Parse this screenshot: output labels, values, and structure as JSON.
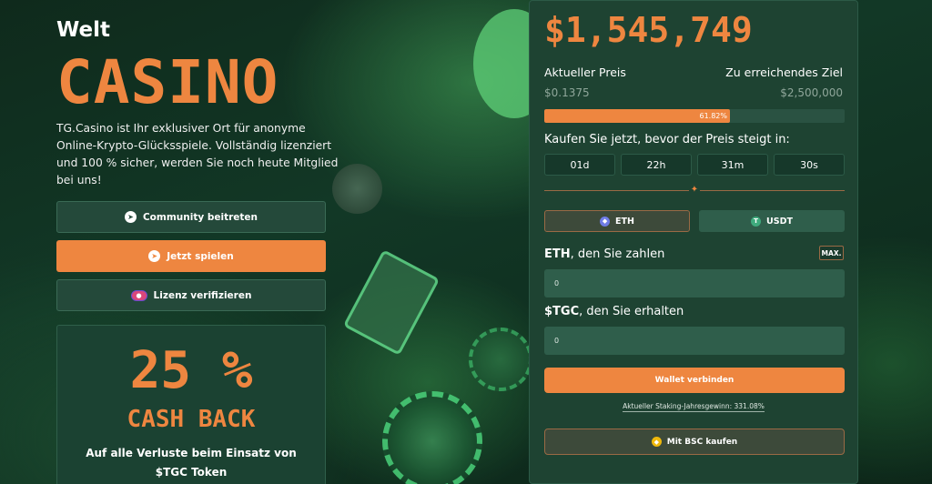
{
  "hero": {
    "welt": "Welt",
    "casino": "CASINO",
    "description": "TG.Casino ist Ihr exklusiver Ort für anonyme Online-Krypto-Glücksspiele. Vollständig lizenziert und 100 % sicher, werden Sie noch heute Mitglied bei uns!"
  },
  "buttons": {
    "community": "Community beitreten",
    "play": "Jetzt spielen",
    "license": "Lizenz verifizieren"
  },
  "icons": {
    "community": "telegram-icon",
    "play": "telegram-icon",
    "license": "license-badge-icon"
  },
  "cashback": {
    "percent": "25 %",
    "title": "CASH BACK",
    "description": "Auf alle Verluste beim Einsatz von $TGC Token"
  },
  "presale": {
    "raised": "$1,545,749",
    "current_price_label": "Aktueller Preis",
    "current_price": "$0.1375",
    "target_label": "Zu erreichendes Ziel",
    "target": "$2,500,000",
    "progress_percent": 61.82,
    "progress_label": "61.82%",
    "timer_label": "Kaufen Sie jetzt, bevor der Preis steigt in:",
    "timer": [
      "01d",
      "22h",
      "31m",
      "30s"
    ],
    "tokens": [
      {
        "label": "ETH",
        "icon": "eth-icon"
      },
      {
        "label": "USDT",
        "icon": "usdt-icon"
      }
    ],
    "pay_currency": "ETH",
    "pay_label_rest": ", den Sie zahlen",
    "max_label": "MAX.",
    "pay_value": "0",
    "receive_currency": "$TGC",
    "receive_label_rest": ", den Sie erhalten",
    "receive_value": "0",
    "connect_wallet": "Wallet verbinden",
    "staking_text": "Aktueller Staking-Jahresgewinn: 331.08%",
    "bsc_label": "Mit BSC kaufen"
  },
  "colors": {
    "accent": "#ee8640",
    "panel": "#1e4332",
    "input": "#2f5e4b"
  }
}
